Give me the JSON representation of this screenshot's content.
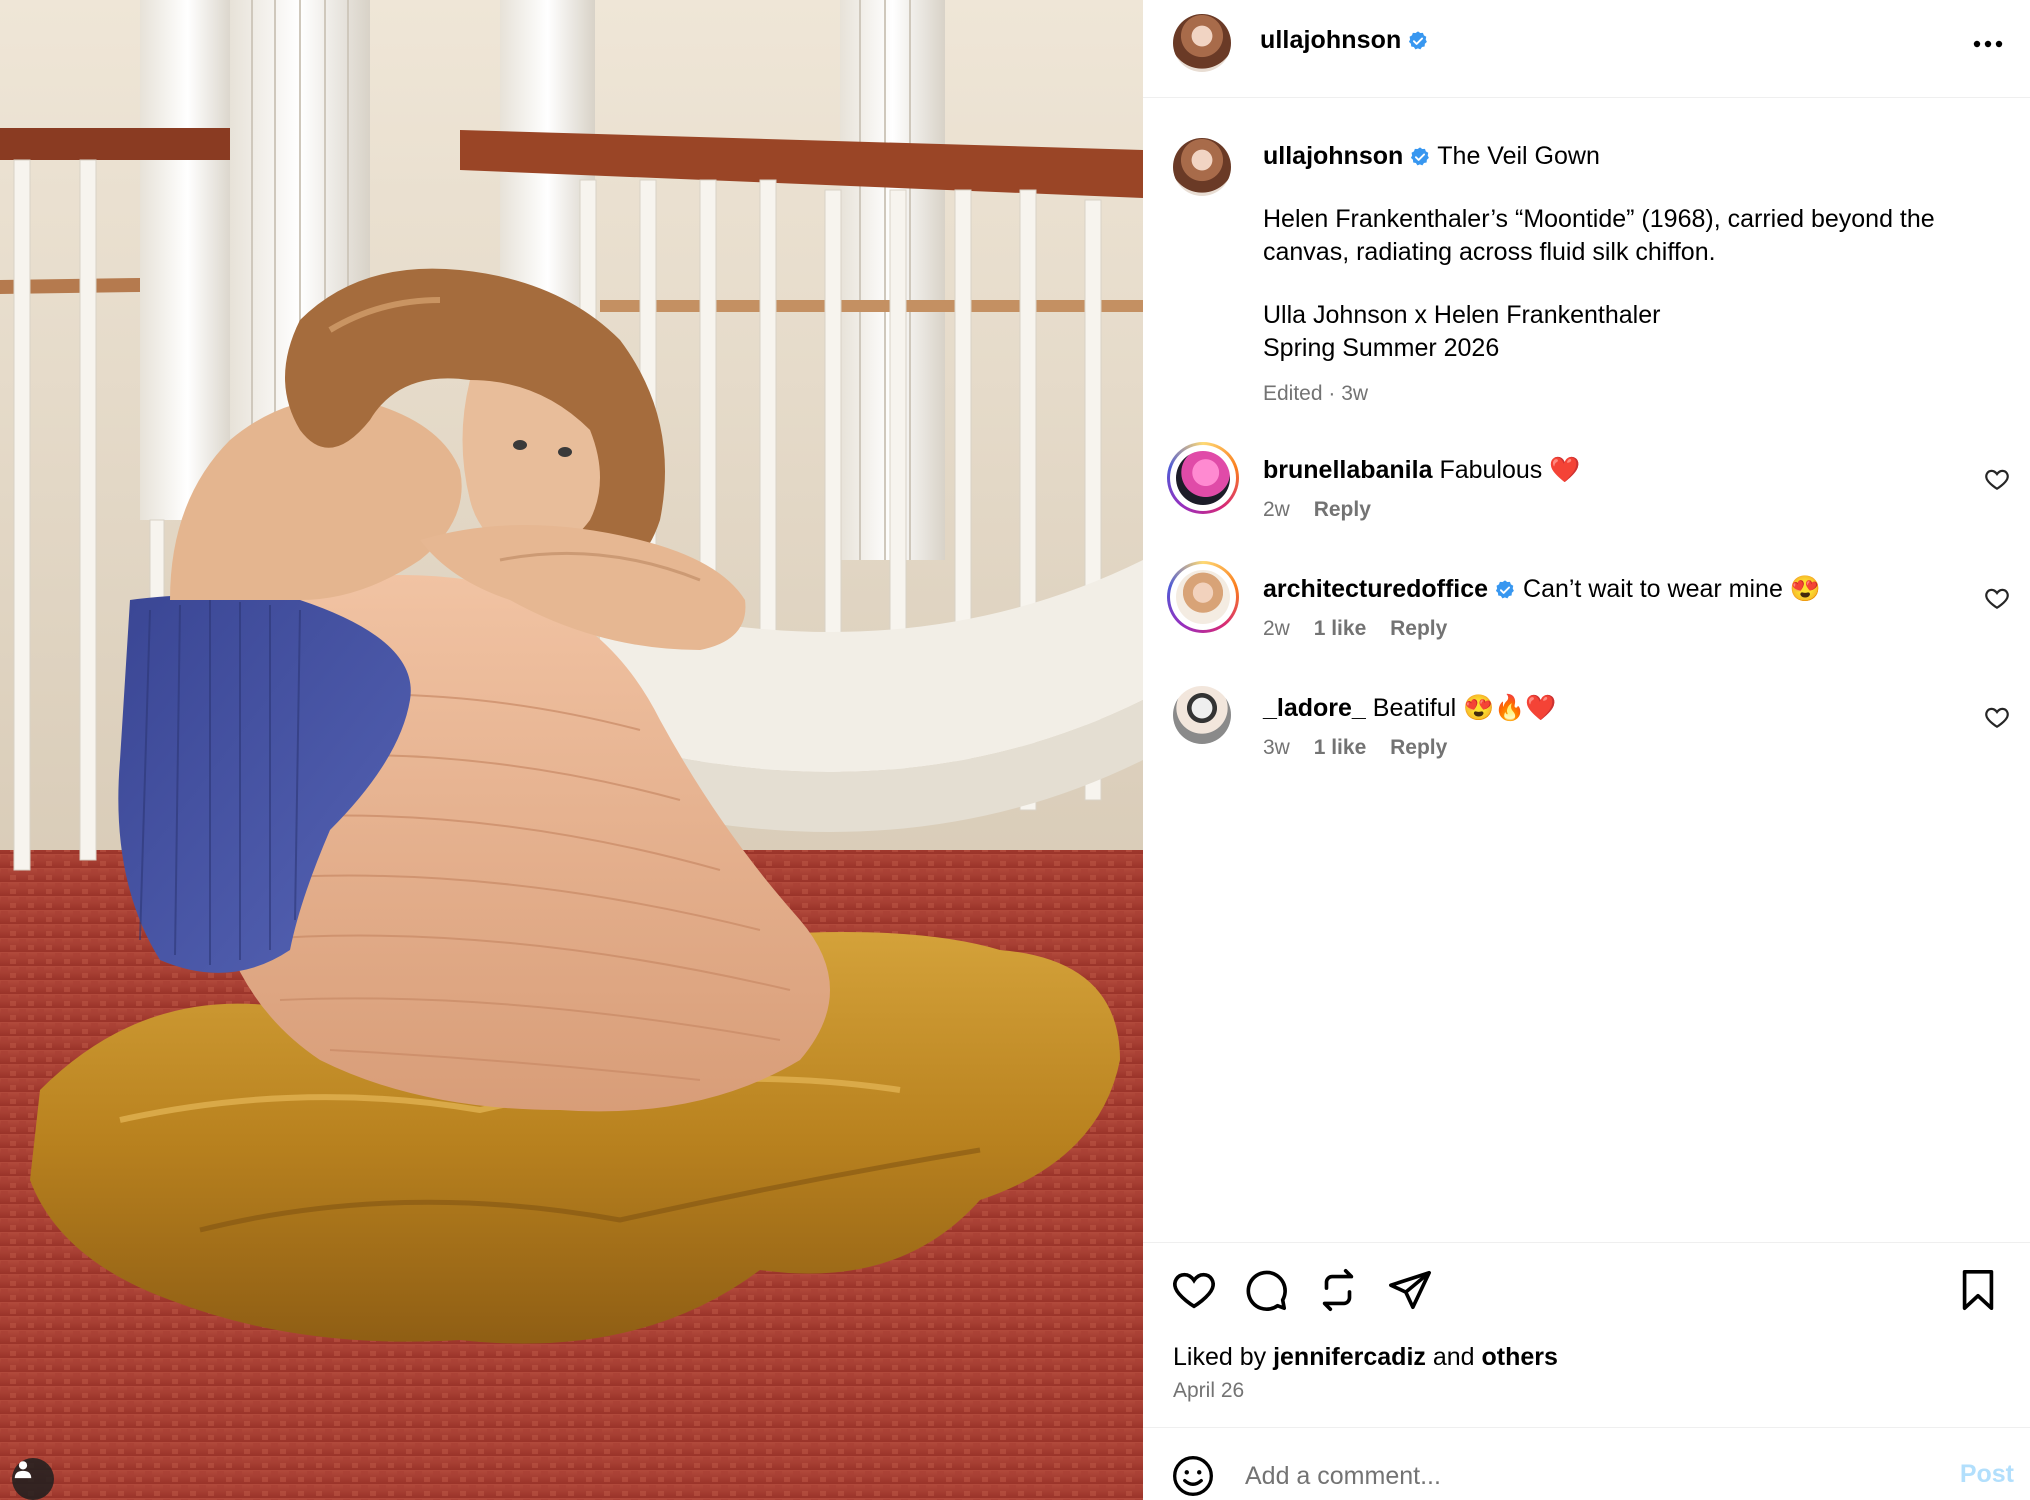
{
  "post": {
    "username": "ullajohnson",
    "verified": true,
    "more_label": "More options"
  },
  "caption": {
    "username": "ullajohnson",
    "title": "The Veil Gown",
    "line1": "Helen Frankenthaler’s “Moontide” (1968), carried beyond the canvas, radiating across fluid silk chiffon.",
    "line2": "Ulla Johnson x Helen Frankenthaler",
    "line3": "Spring Summer 2026",
    "meta": "Edited · 3w"
  },
  "comments": [
    {
      "username": "brunellabanila",
      "verified": false,
      "text": "Fabulous",
      "emoji": "❤️",
      "time": "2w",
      "likes": "",
      "reply": "Reply"
    },
    {
      "username": "architecturedoffice",
      "verified": true,
      "text": "Can’t wait to wear mine",
      "emoji": "😍",
      "time": "2w",
      "likes": "1 like",
      "reply": "Reply"
    },
    {
      "username": "_ladore_",
      "verified": false,
      "text": "Beatiful",
      "emoji": "😍🔥❤️",
      "time": "3w",
      "likes": "1 like",
      "reply": "Reply"
    }
  ],
  "likes": {
    "prefix": "Liked by",
    "user": "jennifercadiz",
    "and": "and",
    "others": "others"
  },
  "date": "April 26",
  "add_comment": {
    "placeholder": "Add a comment...",
    "post_label": "Post"
  },
  "colors": {
    "verified_blue": "#3897f0",
    "muted_text": "#737373",
    "post_button": "#b2dffc",
    "divider": "#efefef"
  },
  "icons": [
    "verified-badge-icon",
    "more-icon",
    "heart-icon",
    "comment-icon",
    "repost-icon",
    "share-icon",
    "bookmark-icon",
    "emoji-icon",
    "user-tag-icon"
  ]
}
